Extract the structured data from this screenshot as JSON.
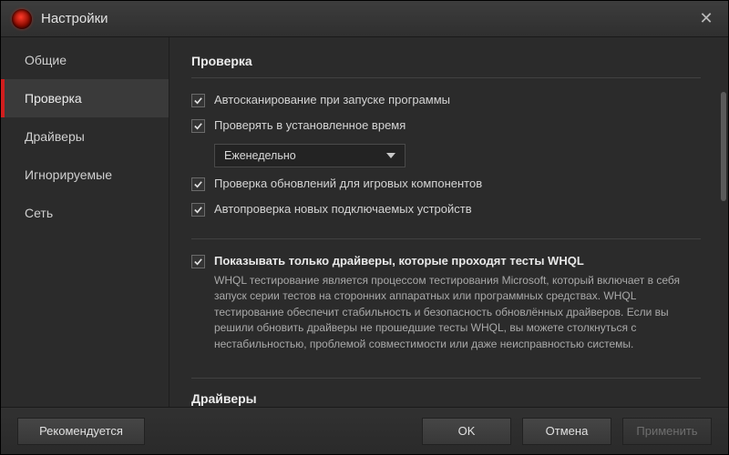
{
  "titlebar": {
    "title": "Настройки"
  },
  "sidebar": {
    "items": [
      {
        "label": "Общие"
      },
      {
        "label": "Проверка"
      },
      {
        "label": "Драйверы"
      },
      {
        "label": "Игнорируемые"
      },
      {
        "label": "Сеть"
      }
    ],
    "active_index": 1
  },
  "sections": {
    "scan": {
      "heading": "Проверка",
      "autoscan": "Автосканирование при запуске программы",
      "scheduled": "Проверять в установленное время",
      "schedule_select": "Еженедельно",
      "game_updates": "Проверка обновлений для игровых компонентов",
      "autodetect": "Автопроверка новых подключаемых устройств",
      "whql_label": "Показывать только драйверы, которые проходят тесты WHQL",
      "whql_desc": "WHQL тестирование является процессом тестирования Microsoft, который включает в себя запуск серии тестов на сторонних аппаратных или программных средствах. WHQL тестирование обеспечит стабильность и безопасность обновлённых драйверов. Если вы решили обновить драйверы не прошедшие тесты WHQL, вы можете столкнуться с нестабильностью, проблемой совместимости или даже неисправностью системы."
    },
    "drivers": {
      "heading": "Драйверы"
    }
  },
  "footer": {
    "recommended": "Рекомендуется",
    "ok": "OK",
    "cancel": "Отмена",
    "apply": "Применить"
  }
}
